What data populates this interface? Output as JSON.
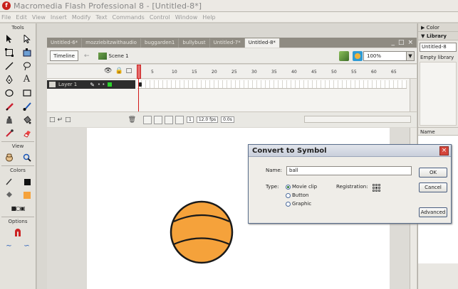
{
  "window": {
    "title": "Macromedia Flash Professional 8 - [Untitled-8*]"
  },
  "menu": [
    "File",
    "Edit",
    "View",
    "Insert",
    "Modify",
    "Text",
    "Commands",
    "Control",
    "Window",
    "Help"
  ],
  "tools": {
    "label": "Tools",
    "view_label": "View",
    "colors_label": "Colors",
    "options_label": "Options"
  },
  "doc_tabs": [
    "Untitled-6*",
    "mozziebitzwithaudio",
    "buggarden1",
    "bullybust",
    "Untitled-7*",
    "Untitled-8*"
  ],
  "doc_controls": {
    "minimize": "_",
    "restore": "&#x25a1;",
    "close": "x"
  },
  "toolbar": {
    "timeline_button": "Timeline",
    "back_arrow": "←",
    "scene": "Scene 1",
    "zoom": "100%"
  },
  "timeline": {
    "layer_name": "Layer 1",
    "frame_numbers": [
      "1",
      "5",
      "10",
      "15",
      "20",
      "25",
      "30",
      "35",
      "40",
      "45",
      "50",
      "55",
      "60",
      "65"
    ],
    "current_frame": "1",
    "frame_rate": "12.0 fps",
    "elapsed": "0.0s"
  },
  "dialog": {
    "title": "Convert to Symbol",
    "name_label": "Name:",
    "name_value": "ball",
    "type_label": "Type:",
    "types": [
      {
        "label": "Movie clip",
        "selected": true
      },
      {
        "label": "Button",
        "selected": false
      },
      {
        "label": "Graphic",
        "selected": false
      }
    ],
    "registration_label": "Registration:",
    "ok": "OK",
    "cancel": "Cancel",
    "advanced": "Advanced"
  },
  "right_panel": {
    "color_header": "Color",
    "library_header": "Library",
    "library_select": "Untitled-8",
    "library_empty": "Empty library",
    "name_column": "Name"
  },
  "colors": {
    "ball_fill": "#f5a23b",
    "ball_stroke": "#1a1a1a",
    "dialog_border": "#5a6e8c"
  }
}
